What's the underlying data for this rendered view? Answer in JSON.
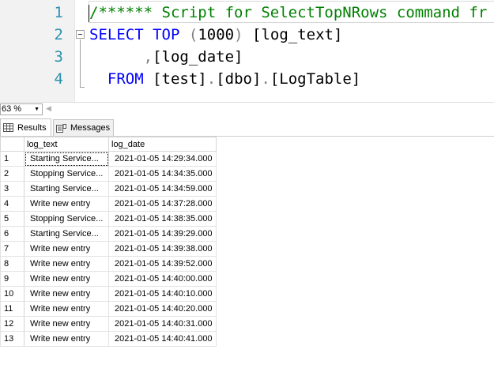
{
  "editor": {
    "line_numbers": [
      "1",
      "2",
      "3",
      "4"
    ],
    "line1": {
      "comment": "/****** Script for SelectTopNRows command fr"
    },
    "line2": {
      "kw_select": "SELECT",
      "kw_top": "TOP",
      "paren_open": "(",
      "num": "1000",
      "paren_close": ")",
      "col": "[log_text]"
    },
    "line3": {
      "comma": ",",
      "col": "[log_date]"
    },
    "line4": {
      "kw_from": "FROM",
      "db": "[test]",
      "dot1": ".",
      "schema": "[dbo]",
      "dot2": ".",
      "table": "[LogTable]"
    }
  },
  "zoom": {
    "value": "63 %"
  },
  "tabs": {
    "results": "Results",
    "messages": "Messages"
  },
  "grid": {
    "columns": [
      "log_text",
      "log_date"
    ],
    "rows": [
      {
        "n": "1",
        "text": "Starting Service...",
        "date": "2021-01-05 14:29:34.000"
      },
      {
        "n": "2",
        "text": "Stopping Service...",
        "date": "2021-01-05 14:34:35.000"
      },
      {
        "n": "3",
        "text": "Starting Service...",
        "date": "2021-01-05 14:34:59.000"
      },
      {
        "n": "4",
        "text": "Write new entry",
        "date": "2021-01-05 14:37:28.000"
      },
      {
        "n": "5",
        "text": "Stopping Service...",
        "date": "2021-01-05 14:38:35.000"
      },
      {
        "n": "6",
        "text": "Starting Service...",
        "date": "2021-01-05 14:39:29.000"
      },
      {
        "n": "7",
        "text": "Write new entry",
        "date": "2021-01-05 14:39:38.000"
      },
      {
        "n": "8",
        "text": "Write new entry",
        "date": "2021-01-05 14:39:52.000"
      },
      {
        "n": "9",
        "text": "Write new entry",
        "date": "2021-01-05 14:40:00.000"
      },
      {
        "n": "10",
        "text": "Write new entry",
        "date": "2021-01-05 14:40:10.000"
      },
      {
        "n": "11",
        "text": "Write new entry",
        "date": "2021-01-05 14:40:20.000"
      },
      {
        "n": "12",
        "text": "Write new entry",
        "date": "2021-01-05 14:40:31.000"
      },
      {
        "n": "13",
        "text": "Write new entry",
        "date": "2021-01-05 14:40:41.000"
      }
    ]
  },
  "colors": {
    "keyword": "#0000ff",
    "comment": "#008000",
    "line_number": "#2b91af",
    "operator": "#808080"
  },
  "icons": {
    "results_tab": "grid-icon",
    "messages_tab": "messages-icon",
    "zoom_dropdown": "chevron-down-icon",
    "collapse": "collapse-minus-icon"
  }
}
